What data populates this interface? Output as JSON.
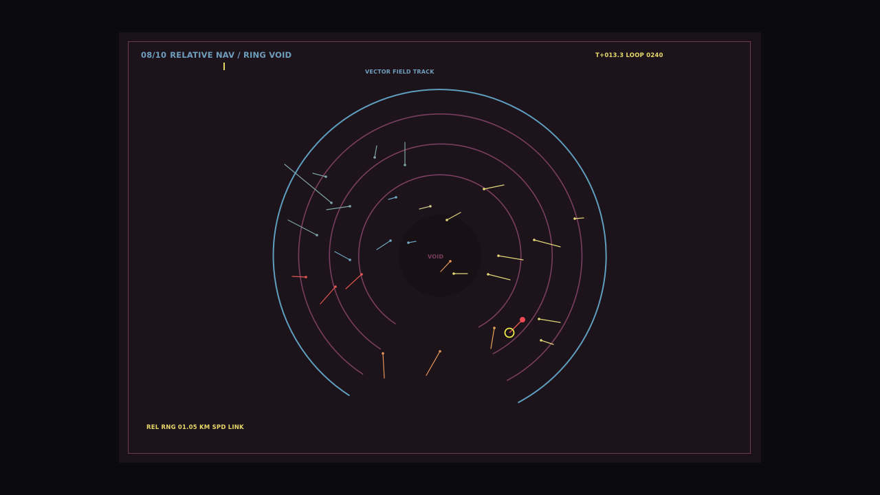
{
  "header": {
    "counter": "08/10",
    "title": "RELATIVE NAV / RING VOID",
    "status": "T+013.3  LOOP 0240",
    "sublabel": "VECTOR FIELD  TRACK"
  },
  "void_label": "VOID",
  "footer": {
    "readout": "REL RNG 01.05 KM  SPD LINK"
  },
  "colors": {
    "background": "#0b0a0c",
    "panel": "#1d131b",
    "frame": "#6e3a52",
    "title_blue": "#6f9fbd",
    "accent_yellow": "#e6d96a",
    "ring_pink": "#7a3f5e",
    "ring_outer_blue": "#5f9fc0",
    "void_fill": "#171116",
    "void_text": "#7a3f5e",
    "vector_teal": "#7fa6a8",
    "vector_blue": "#6fa7c2",
    "vector_yellow": "#e3d77a",
    "vector_orange": "#e8955a",
    "vector_red": "#e3594f",
    "marker_red": "#ef4a55",
    "cursor_yellow": "#f1ec4a"
  },
  "icons": {
    "target_cursor": "circle-reticle-icon"
  }
}
